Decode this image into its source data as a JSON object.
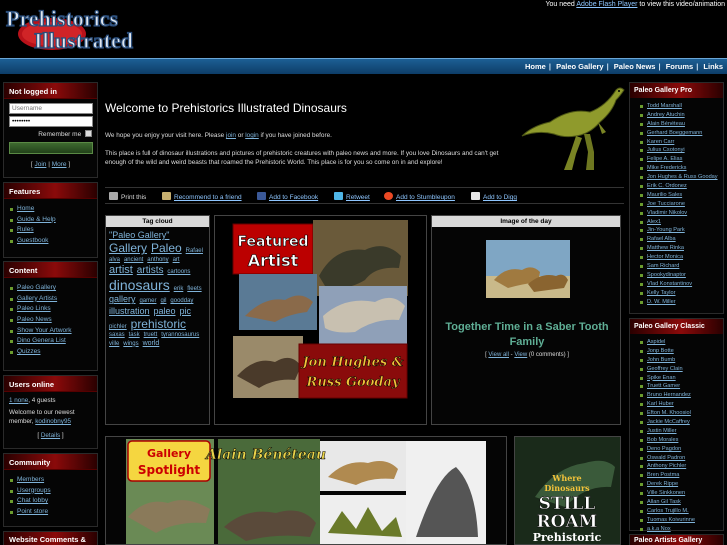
{
  "header": {
    "logo_line1": "Prehistorics",
    "logo_line2": "Illustrated",
    "flash_prefix": "You need",
    "flash_link": "Adobe Flash Player",
    "flash_suffix": "to view this video/animation",
    "nav": [
      "Home",
      "Paleo Gallery",
      "Paleo News",
      "Forums",
      "Links"
    ]
  },
  "login": {
    "title": "Not logged in",
    "username_placeholder": "Username",
    "password_value": "••••••••",
    "remember_label": "Remember me",
    "join": "Join",
    "more": "More"
  },
  "features": {
    "title": "Features",
    "items": [
      "Home",
      "Guide & Help",
      "Rules",
      "Guestbook"
    ]
  },
  "content": {
    "title": "Content",
    "items": [
      "Paleo Gallery",
      "Gallery Artists",
      "Paleo Links",
      "Paleo News",
      "Show Your Artwork",
      "Dino Genera List",
      "Quizzes"
    ]
  },
  "users_online": {
    "title": "Users online",
    "count_user": "1 none",
    "count_suffix": ", 4 guests",
    "newest_text": "Welcome to our newest member,",
    "newest_member": "kodinobny95",
    "details": "Details"
  },
  "community": {
    "title": "Community",
    "items": [
      "Members",
      "Usergroups",
      "Chat lobby",
      "Point store"
    ]
  },
  "website_comments": {
    "title": "Website Comments &"
  },
  "welcome": {
    "title": "Welcome to Prehistorics Illustrated Dinosaurs",
    "line1_a": "We hope you enjoy your visit here. Please",
    "line1_join": "join",
    "line1_or": "or",
    "line1_login": "login",
    "line1_b": "if you have joined before.",
    "para2": "This place is full of dinosaur illustrations and pictures of prehistoric creatures with paleo news and more. If you love Dinosaurs and can't get enough of the wild and weird beasts that roamed the Prehistoric World. This place is for you so come on in and explore!"
  },
  "share": {
    "print": "Print this",
    "recommend": "Recommend to a friend",
    "facebook": "Add to Facebook",
    "retweet": "Retweet",
    "stumble": "Add to Stumbleupon",
    "digg": "Add to Digg"
  },
  "tag_cloud": {
    "title": "Tag cloud",
    "tags": [
      {
        "t": "\"Paleo Gallery\"",
        "s": 9
      },
      {
        "t": "Gallery",
        "s": 12
      },
      {
        "t": "Paleo",
        "s": 12
      },
      {
        "t": "Rafael",
        "s": 6
      },
      {
        "t": "alva",
        "s": 6
      },
      {
        "t": "ancient",
        "s": 6
      },
      {
        "t": "anthony",
        "s": 6
      },
      {
        "t": "art",
        "s": 6
      },
      {
        "t": "artist",
        "s": 11
      },
      {
        "t": "artists",
        "s": 10
      },
      {
        "t": "cartoons",
        "s": 6
      },
      {
        "t": "dinosaurs",
        "s": 14
      },
      {
        "t": "erik",
        "s": 6
      },
      {
        "t": "fleets",
        "s": 6
      },
      {
        "t": "gallery",
        "s": 9
      },
      {
        "t": "gamer",
        "s": 6
      },
      {
        "t": "gil",
        "s": 6
      },
      {
        "t": "goodday",
        "s": 6
      },
      {
        "t": "illustration",
        "s": 9
      },
      {
        "t": "paleo",
        "s": 9
      },
      {
        "t": "pic",
        "s": 9
      },
      {
        "t": "pichler",
        "s": 6
      },
      {
        "t": "prehistoric",
        "s": 12
      },
      {
        "t": "saxas",
        "s": 6
      },
      {
        "t": "task",
        "s": 6
      },
      {
        "t": "truett",
        "s": 6
      },
      {
        "t": "tyrannosaurus",
        "s": 6
      },
      {
        "t": "ville",
        "s": 6
      },
      {
        "t": "wings",
        "s": 6
      },
      {
        "t": "world",
        "s": 7
      }
    ]
  },
  "featured": {
    "badge1": "Featured",
    "badge2": "Artist",
    "caption1": "Jon Hughes &",
    "caption2": "Russ Gooday"
  },
  "image_day": {
    "title": "Image of the day",
    "caption": "Together Time in a Saber Tooth Family",
    "view_all": "View all",
    "view": "View",
    "comments": "(0 comments)"
  },
  "spotlight": {
    "badge1": "Gallery",
    "badge2": "Spotlight",
    "artist": "Alain Bénéteau"
  },
  "still_roam": {
    "line1": "Where",
    "line2": "Dinosaurs",
    "line3": "STILL",
    "line4": "ROAM",
    "line5": "Prehistoric"
  },
  "gallery_pro": {
    "title": "Paleo Gallery Pro",
    "items": [
      "Todd Marshall",
      "Andrey Atuchin",
      "Alain Bénéteau",
      "Gerhard Boeggemann",
      "Karen Carr",
      "Julius Csotonyi",
      "Felipe A. Elias",
      "Mike Fredericks",
      "Jon Hughes & Russ Gooday",
      "Erik C. Ordonez",
      "Maurilio Sales",
      "Joe Tucciarone",
      "Vladimir Nikolov",
      "Alex1",
      "Jin-Young Park",
      "Rafael Alba",
      "Matthew Rinka",
      "Hector Monica",
      "Sam Richard",
      "Spookydinaptor",
      "Vlad Konstantinov",
      "Kelly Taylor",
      "D. W. Miller"
    ]
  },
  "gallery_classic": {
    "title": "Paleo Gallery Classic",
    "items": [
      "Aspidel",
      "Jonp Botte",
      "John Bumb",
      "Geoffrey Clain",
      "Spike Enan",
      "Truett Gamer",
      "Bruno Hernandez",
      "Karl Huber",
      "Efton M. Khoosiol",
      "Jackie McCaffrey",
      "Justin Miller",
      "Bob Morales",
      "Deno Pagdon",
      "Oswald Padron",
      "Anthony Pichler",
      "Bren Postma",
      "Derek Rippe",
      "Ville Sinkkonen",
      "Allan Gil Task",
      "Carlos Trujillo M.",
      "Tuomas Koivurinne",
      "a.k.a Nox"
    ]
  },
  "artists_gallery": {
    "title": "Paleo Artists Gallery"
  }
}
